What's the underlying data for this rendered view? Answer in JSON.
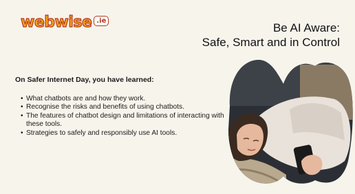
{
  "brand": {
    "name": "webwise",
    "tld": ".ie"
  },
  "header": {
    "title_line1": "Be AI Aware:",
    "title_line2": "Safe, Smart and in Control"
  },
  "content": {
    "intro": "On Safer Internet Day, you have learned:",
    "bullets": [
      "What chatbots are and how they work.",
      "Recognise the risks and benefits of using chatbots.",
      "The features of chatbot design and limitations of interacting with these tools.",
      "Strategies to safely and responsibly use AI tools."
    ]
  },
  "colors": {
    "background": "#f7f4ec",
    "logo_orange": "#f6a21b",
    "logo_red": "#b23a1e"
  },
  "image": {
    "subject": "person-lying-on-couch-using-phone"
  }
}
